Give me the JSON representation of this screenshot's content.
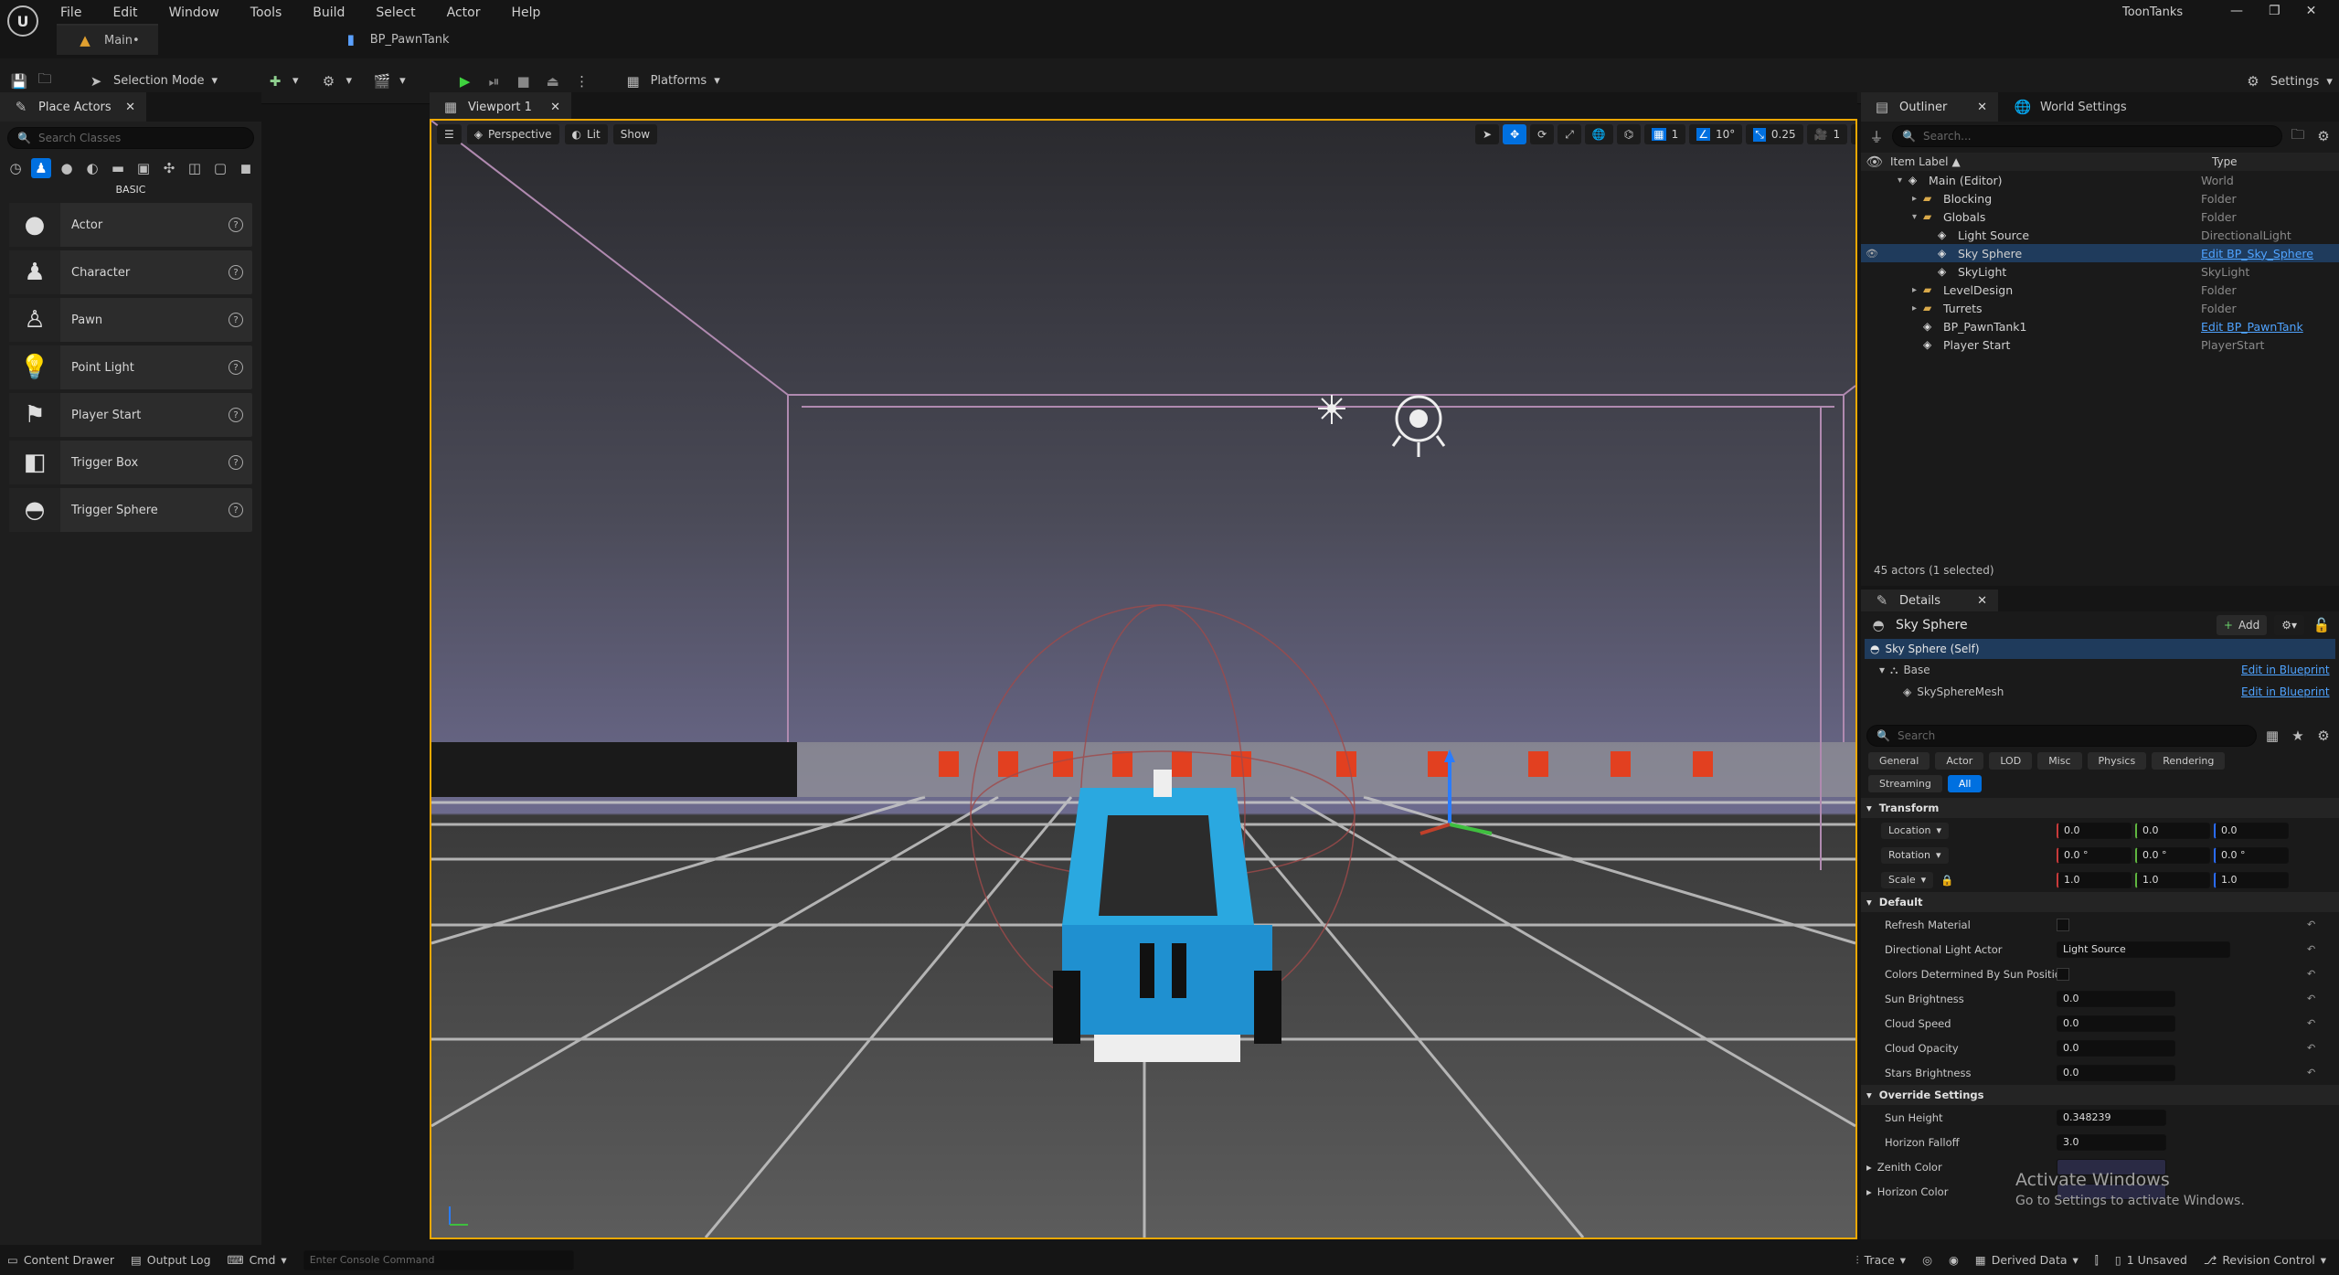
{
  "app": {
    "project_name": "ToonTanks"
  },
  "menu": [
    "File",
    "Edit",
    "Window",
    "Tools",
    "Build",
    "Select",
    "Actor",
    "Help"
  ],
  "doc_tabs": [
    {
      "label": "Main•"
    },
    {
      "label": "BP_PawnTank"
    }
  ],
  "toolbar": {
    "selection_mode": "Selection Mode",
    "platforms": "Platforms",
    "settings": "Settings"
  },
  "place_actors": {
    "tab": "Place Actors",
    "search_placeholder": "Search Classes",
    "category": "BASIC",
    "items": [
      {
        "label": "Actor",
        "icon": "sphere-icon"
      },
      {
        "label": "Character",
        "icon": "character-icon"
      },
      {
        "label": "Pawn",
        "icon": "pawn-icon"
      },
      {
        "label": "Point Light",
        "icon": "bulb-icon"
      },
      {
        "label": "Player Start",
        "icon": "flag-icon"
      },
      {
        "label": "Trigger Box",
        "icon": "cube-icon"
      },
      {
        "label": "Trigger Sphere",
        "icon": "sphere-icon"
      }
    ]
  },
  "viewport": {
    "tab": "Viewport 1",
    "perspective": "Perspective",
    "lit": "Lit",
    "show": "Show",
    "grid_value": "1",
    "angle_value": "10°",
    "scale_value": "0.25",
    "camera_value": "1"
  },
  "outliner": {
    "tab": "Outliner",
    "world_tab": "World Settings",
    "search_placeholder": "Search...",
    "col_label": "Item Label",
    "col_type": "Type",
    "rows": [
      {
        "label": "Main (Editor)",
        "type": "World",
        "indent": 1,
        "link": false,
        "selected": false,
        "exp": "▾"
      },
      {
        "label": "Blocking",
        "type": "Folder",
        "indent": 2,
        "link": false,
        "selected": false,
        "exp": "▸"
      },
      {
        "label": "Globals",
        "type": "Folder",
        "indent": 2,
        "link": false,
        "selected": false,
        "exp": "▾"
      },
      {
        "label": "Light Source",
        "type": "DirectionalLight",
        "indent": 3,
        "link": false,
        "selected": false,
        "exp": ""
      },
      {
        "label": "Sky Sphere",
        "type": "Edit BP_Sky_Sphere",
        "indent": 3,
        "link": true,
        "selected": true,
        "exp": ""
      },
      {
        "label": "SkyLight",
        "type": "SkyLight",
        "indent": 3,
        "link": false,
        "selected": false,
        "exp": ""
      },
      {
        "label": "LevelDesign",
        "type": "Folder",
        "indent": 2,
        "link": false,
        "selected": false,
        "exp": "▸"
      },
      {
        "label": "Turrets",
        "type": "Folder",
        "indent": 2,
        "link": false,
        "selected": false,
        "exp": "▸"
      },
      {
        "label": "BP_PawnTank1",
        "type": "Edit BP_PawnTank",
        "indent": 2,
        "link": true,
        "selected": false,
        "exp": ""
      },
      {
        "label": "Player Start",
        "type": "PlayerStart",
        "indent": 2,
        "link": false,
        "selected": false,
        "exp": ""
      }
    ],
    "status": "45 actors (1 selected)"
  },
  "details": {
    "tab": "Details",
    "object": "Sky Sphere",
    "add": "Add",
    "self": "Sky Sphere (Self)",
    "base": "Base",
    "mesh": "SkySphereMesh",
    "edit_bp": "Edit in Blueprint",
    "search_placeholder": "Search",
    "filters": [
      "General",
      "Actor",
      "LOD",
      "Misc",
      "Physics",
      "Rendering"
    ],
    "filters2": [
      "Streaming",
      "All"
    ],
    "transform": "Transform",
    "location": "Location",
    "rotation": "Rotation",
    "scale": "Scale",
    "loc": [
      "0.0",
      "0.0",
      "0.0"
    ],
    "rot": [
      "0.0 °",
      "0.0 °",
      "0.0 °"
    ],
    "scl": [
      "1.0",
      "1.0",
      "1.0"
    ],
    "default": "Default",
    "props": [
      {
        "label": "Refresh Material",
        "kind": "check"
      },
      {
        "label": "Directional Light Actor",
        "kind": "select",
        "value": "Light Source"
      },
      {
        "label": "Colors Determined By Sun Position",
        "kind": "check"
      },
      {
        "label": "Sun Brightness",
        "kind": "num",
        "value": "0.0"
      },
      {
        "label": "Cloud Speed",
        "kind": "num",
        "value": "0.0"
      },
      {
        "label": "Cloud Opacity",
        "kind": "num",
        "value": "0.0"
      },
      {
        "label": "Stars Brightness",
        "kind": "num",
        "value": "0.0"
      }
    ],
    "override": "Override Settings",
    "props2": [
      {
        "label": "Sun Height",
        "value": "0.348239"
      },
      {
        "label": "Horizon Falloff",
        "value": "3.0"
      },
      {
        "label": "Zenith Color",
        "value": ""
      },
      {
        "label": "Horizon Color",
        "value": ""
      }
    ]
  },
  "bottom": {
    "content_drawer": "Content Drawer",
    "output_log": "Output Log",
    "cmd": "Cmd",
    "console_placeholder": "Enter Console Command",
    "trace": "Trace",
    "derived_data": "Derived Data",
    "unsaved": "1 Unsaved",
    "revision": "Revision Control"
  },
  "watermark": {
    "line1": "Activate Windows",
    "line2": "Go to Settings to activate Windows."
  },
  "colors": {
    "accent": "#0070e0",
    "selected": "#1f3b5c",
    "link": "#4fa3ff",
    "viewport_border": "#f0a800"
  }
}
